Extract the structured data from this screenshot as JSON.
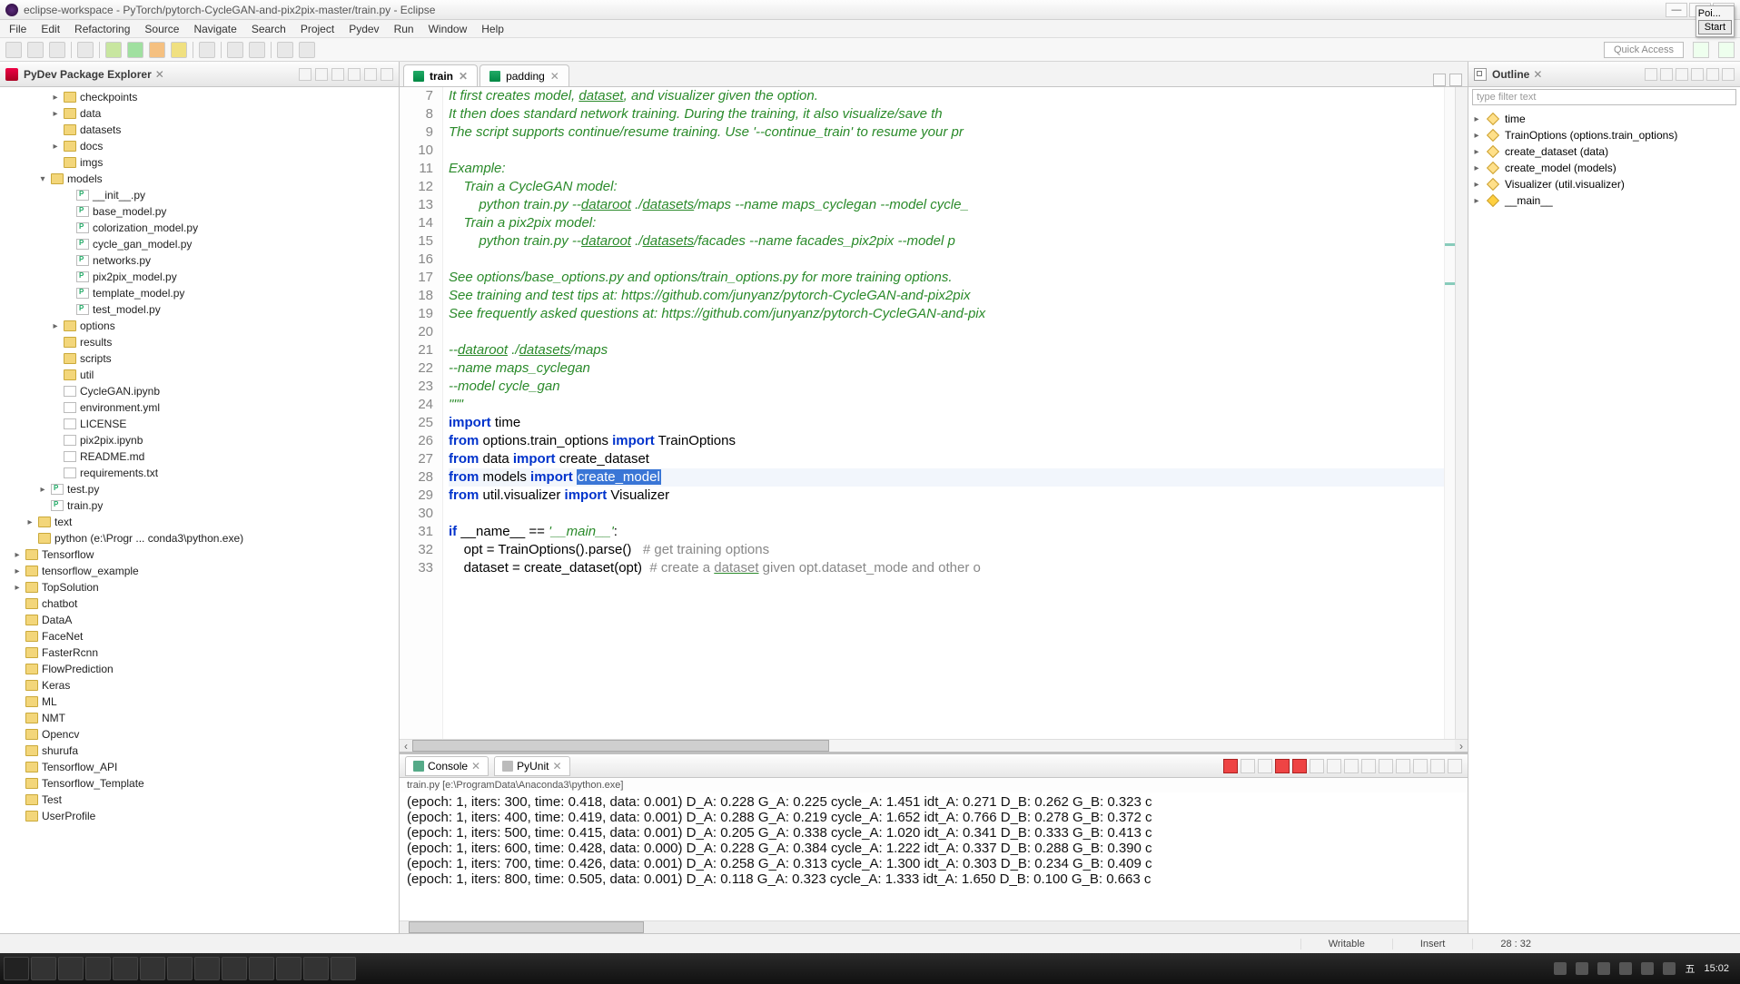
{
  "window": {
    "title": "eclipse-workspace - PyTorch/pytorch-CycleGAN-and-pix2pix-master/train.py - Eclipse"
  },
  "float": {
    "label": "Poi...",
    "start": "Start"
  },
  "menu": [
    "File",
    "Edit",
    "Refactoring",
    "Source",
    "Navigate",
    "Search",
    "Project",
    "Pydev",
    "Run",
    "Window",
    "Help"
  ],
  "quick_access": "Quick Access",
  "pkg": {
    "title": "PyDev Package Explorer",
    "tree": [
      {
        "d": 4,
        "t": "e",
        "i": "folder",
        "l": "checkpoints"
      },
      {
        "d": 4,
        "t": "e",
        "i": "folder",
        "l": "data"
      },
      {
        "d": 4,
        "t": "s",
        "i": "folder",
        "l": "datasets"
      },
      {
        "d": 4,
        "t": "e",
        "i": "folder",
        "l": "docs"
      },
      {
        "d": 4,
        "t": "s",
        "i": "folder",
        "l": "imgs"
      },
      {
        "d": 3,
        "t": "o",
        "i": "folder",
        "l": "models"
      },
      {
        "d": 5,
        "t": "s",
        "i": "pyfile",
        "l": "__init__.py"
      },
      {
        "d": 5,
        "t": "s",
        "i": "pyfile",
        "l": "base_model.py"
      },
      {
        "d": 5,
        "t": "s",
        "i": "pyfile",
        "l": "colorization_model.py"
      },
      {
        "d": 5,
        "t": "s",
        "i": "pyfile",
        "l": "cycle_gan_model.py"
      },
      {
        "d": 5,
        "t": "s",
        "i": "pyfile",
        "l": "networks.py"
      },
      {
        "d": 5,
        "t": "s",
        "i": "pyfile",
        "l": "pix2pix_model.py"
      },
      {
        "d": 5,
        "t": "s",
        "i": "pyfile",
        "l": "template_model.py"
      },
      {
        "d": 5,
        "t": "s",
        "i": "pyfile",
        "l": "test_model.py"
      },
      {
        "d": 4,
        "t": "e",
        "i": "folder",
        "l": "options"
      },
      {
        "d": 4,
        "t": "s",
        "i": "folder",
        "l": "results"
      },
      {
        "d": 4,
        "t": "s",
        "i": "folder",
        "l": "scripts"
      },
      {
        "d": 4,
        "t": "s",
        "i": "folder",
        "l": "util"
      },
      {
        "d": 4,
        "t": "s",
        "i": "file",
        "l": "CycleGAN.ipynb"
      },
      {
        "d": 4,
        "t": "s",
        "i": "file",
        "l": "environment.yml"
      },
      {
        "d": 4,
        "t": "s",
        "i": "file",
        "l": "LICENSE"
      },
      {
        "d": 4,
        "t": "s",
        "i": "file",
        "l": "pix2pix.ipynb"
      },
      {
        "d": 4,
        "t": "s",
        "i": "file",
        "l": "README.md"
      },
      {
        "d": 4,
        "t": "s",
        "i": "file",
        "l": "requirements.txt"
      },
      {
        "d": 3,
        "t": "e",
        "i": "pyfile",
        "l": "test.py"
      },
      {
        "d": 3,
        "t": "s",
        "i": "pyfile",
        "l": "train.py"
      },
      {
        "d": 2,
        "t": "e",
        "i": "folder",
        "l": "text"
      },
      {
        "d": 2,
        "t": "s",
        "i": "proj",
        "l": "python  (e:\\Progr ... conda3\\python.exe)"
      },
      {
        "d": 1,
        "t": "e",
        "i": "proj",
        "l": "Tensorflow"
      },
      {
        "d": 1,
        "t": "e",
        "i": "proj",
        "l": "tensorflow_example"
      },
      {
        "d": 1,
        "t": "e",
        "i": "proj",
        "l": "TopSolution"
      },
      {
        "d": 1,
        "t": "s",
        "i": "proj",
        "l": "chatbot"
      },
      {
        "d": 1,
        "t": "s",
        "i": "proj",
        "l": "DataA"
      },
      {
        "d": 1,
        "t": "s",
        "i": "proj",
        "l": "FaceNet"
      },
      {
        "d": 1,
        "t": "s",
        "i": "proj",
        "l": "FasterRcnn"
      },
      {
        "d": 1,
        "t": "s",
        "i": "proj",
        "l": "FlowPrediction"
      },
      {
        "d": 1,
        "t": "s",
        "i": "proj",
        "l": "Keras"
      },
      {
        "d": 1,
        "t": "s",
        "i": "proj",
        "l": "ML"
      },
      {
        "d": 1,
        "t": "s",
        "i": "proj",
        "l": "NMT"
      },
      {
        "d": 1,
        "t": "s",
        "i": "proj",
        "l": "Opencv"
      },
      {
        "d": 1,
        "t": "s",
        "i": "proj",
        "l": "shurufa"
      },
      {
        "d": 1,
        "t": "s",
        "i": "proj",
        "l": "Tensorflow_API"
      },
      {
        "d": 1,
        "t": "s",
        "i": "proj",
        "l": "Tensorflow_Template"
      },
      {
        "d": 1,
        "t": "s",
        "i": "proj",
        "l": "Test"
      },
      {
        "d": 1,
        "t": "s",
        "i": "proj",
        "l": "UserProfile"
      }
    ]
  },
  "tabs": [
    {
      "label": "train",
      "active": true
    },
    {
      "label": "padding",
      "active": false
    }
  ],
  "editor": {
    "first_line": 7,
    "lines": [
      {
        "n": 7,
        "seg": [
          {
            "c": "c-comment",
            "t": "It first creates model, "
          },
          {
            "c": "c-comment c-under",
            "t": "dataset"
          },
          {
            "c": "c-comment",
            "t": ", and visualizer given the option."
          }
        ]
      },
      {
        "n": 8,
        "seg": [
          {
            "c": "c-comment",
            "t": "It then does standard network training. During the training, it also visualize/save th"
          }
        ]
      },
      {
        "n": 9,
        "seg": [
          {
            "c": "c-comment",
            "t": "The script supports continue/resume training. Use '--continue_train' to resume your pr"
          }
        ]
      },
      {
        "n": 10,
        "seg": []
      },
      {
        "n": 11,
        "seg": [
          {
            "c": "c-comment",
            "t": "Example:"
          }
        ]
      },
      {
        "n": 12,
        "seg": [
          {
            "c": "c-comment",
            "t": "    Train a CycleGAN model:"
          }
        ]
      },
      {
        "n": 13,
        "seg": [
          {
            "c": "c-comment",
            "t": "        python train.py --"
          },
          {
            "c": "c-comment c-under",
            "t": "dataroot"
          },
          {
            "c": "c-comment",
            "t": " ./"
          },
          {
            "c": "c-comment c-under",
            "t": "datasets"
          },
          {
            "c": "c-comment",
            "t": "/maps --name maps_cyclegan --model cycle_"
          }
        ]
      },
      {
        "n": 14,
        "seg": [
          {
            "c": "c-comment",
            "t": "    Train a pix2pix model:"
          }
        ]
      },
      {
        "n": 15,
        "seg": [
          {
            "c": "c-comment",
            "t": "        python train.py --"
          },
          {
            "c": "c-comment c-under",
            "t": "dataroot"
          },
          {
            "c": "c-comment",
            "t": " ./"
          },
          {
            "c": "c-comment c-under",
            "t": "datasets"
          },
          {
            "c": "c-comment",
            "t": "/facades --name facades_pix2pix --model p"
          }
        ]
      },
      {
        "n": 16,
        "seg": []
      },
      {
        "n": 17,
        "seg": [
          {
            "c": "c-comment",
            "t": "See options/base_options.py and options/train_options.py for more training options."
          }
        ]
      },
      {
        "n": 18,
        "seg": [
          {
            "c": "c-comment",
            "t": "See training and test tips at: https://github.com/junyanz/pytorch-CycleGAN-and-pix2pix"
          }
        ]
      },
      {
        "n": 19,
        "seg": [
          {
            "c": "c-comment",
            "t": "See frequently asked questions at: https://github.com/junyanz/pytorch-CycleGAN-and-pix"
          }
        ]
      },
      {
        "n": 20,
        "seg": []
      },
      {
        "n": 21,
        "seg": [
          {
            "c": "c-comment",
            "t": "--"
          },
          {
            "c": "c-comment c-under",
            "t": "dataroot"
          },
          {
            "c": "c-comment",
            "t": " ./"
          },
          {
            "c": "c-comment c-under",
            "t": "datasets"
          },
          {
            "c": "c-comment",
            "t": "/maps"
          }
        ]
      },
      {
        "n": 22,
        "seg": [
          {
            "c": "c-comment",
            "t": "--name maps_cyclegan"
          }
        ]
      },
      {
        "n": 23,
        "seg": [
          {
            "c": "c-comment",
            "t": "--model cycle_gan"
          }
        ]
      },
      {
        "n": 24,
        "seg": [
          {
            "c": "c-str",
            "t": "\"\"\""
          }
        ]
      },
      {
        "n": 25,
        "seg": [
          {
            "c": "c-kw",
            "t": "import"
          },
          {
            "c": "",
            "t": " time"
          }
        ]
      },
      {
        "n": 26,
        "seg": [
          {
            "c": "c-kw",
            "t": "from"
          },
          {
            "c": "",
            "t": " options.train_options "
          },
          {
            "c": "c-kw",
            "t": "import"
          },
          {
            "c": "",
            "t": " TrainOptions"
          }
        ]
      },
      {
        "n": 27,
        "seg": [
          {
            "c": "c-kw",
            "t": "from"
          },
          {
            "c": "",
            "t": " data "
          },
          {
            "c": "c-kw",
            "t": "import"
          },
          {
            "c": "",
            "t": " create_dataset"
          }
        ]
      },
      {
        "n": 28,
        "curr": true,
        "seg": [
          {
            "c": "c-kw",
            "t": "from"
          },
          {
            "c": "",
            "t": " models "
          },
          {
            "c": "c-kw",
            "t": "import"
          },
          {
            "c": "",
            "t": " "
          },
          {
            "c": "c-sel",
            "t": "create_model"
          }
        ]
      },
      {
        "n": 29,
        "seg": [
          {
            "c": "c-kw",
            "t": "from"
          },
          {
            "c": "",
            "t": " util.visualizer "
          },
          {
            "c": "c-kw",
            "t": "import"
          },
          {
            "c": "",
            "t": " Visualizer"
          }
        ]
      },
      {
        "n": 30,
        "seg": []
      },
      {
        "n": 31,
        "seg": [
          {
            "c": "c-kw",
            "t": "if"
          },
          {
            "c": "",
            "t": " __name__ == "
          },
          {
            "c": "c-str",
            "t": "'__main__'"
          },
          {
            "c": "",
            "t": ":"
          }
        ]
      },
      {
        "n": 32,
        "seg": [
          {
            "c": "",
            "t": "    opt = TrainOptions().parse()   "
          },
          {
            "c": "c-comment2",
            "t": "# get training options"
          }
        ]
      },
      {
        "n": 33,
        "seg": [
          {
            "c": "",
            "t": "    dataset = create_dataset(opt)  "
          },
          {
            "c": "c-comment2",
            "t": "# create a "
          },
          {
            "c": "c-comment2 c-under",
            "t": "dataset"
          },
          {
            "c": "c-comment2",
            "t": " given opt.dataset_mode and other o"
          }
        ]
      }
    ]
  },
  "console": {
    "tabs": [
      {
        "label": "Console",
        "active": true
      },
      {
        "label": "PyUnit",
        "active": false
      }
    ],
    "launch": "train.py [e:\\ProgramData\\Anaconda3\\python.exe]",
    "lines": [
      "(epoch: 1, iters: 300, time: 0.418, data: 0.001) D_A: 0.228 G_A: 0.225 cycle_A: 1.451 idt_A: 0.271 D_B: 0.262 G_B: 0.323 c",
      "(epoch: 1, iters: 400, time: 0.419, data: 0.001) D_A: 0.288 G_A: 0.219 cycle_A: 1.652 idt_A: 0.766 D_B: 0.278 G_B: 0.372 c",
      "(epoch: 1, iters: 500, time: 0.415, data: 0.001) D_A: 0.205 G_A: 0.338 cycle_A: 1.020 idt_A: 0.341 D_B: 0.333 G_B: 0.413 c",
      "(epoch: 1, iters: 600, time: 0.428, data: 0.000) D_A: 0.228 G_A: 0.384 cycle_A: 1.222 idt_A: 0.337 D_B: 0.288 G_B: 0.390 c",
      "(epoch: 1, iters: 700, time: 0.426, data: 0.001) D_A: 0.258 G_A: 0.313 cycle_A: 1.300 idt_A: 0.303 D_B: 0.234 G_B: 0.409 c",
      "(epoch: 1, iters: 800, time: 0.505, data: 0.001) D_A: 0.118 G_A: 0.323 cycle_A: 1.333 idt_A: 1.650 D_B: 0.100 G_B: 0.663 c"
    ]
  },
  "outline": {
    "title": "Outline",
    "filter": "type filter text",
    "items": [
      {
        "l": "time"
      },
      {
        "l": "TrainOptions (options.train_options)"
      },
      {
        "l": "create_dataset (data)"
      },
      {
        "l": "create_model (models)"
      },
      {
        "l": "Visualizer (util.visualizer)"
      },
      {
        "l": "__main__",
        "main": true
      }
    ]
  },
  "status": {
    "writable": "Writable",
    "insert": "Insert",
    "pos": "28 : 32"
  },
  "taskbar": {
    "time": "15:02",
    "day": "五"
  }
}
